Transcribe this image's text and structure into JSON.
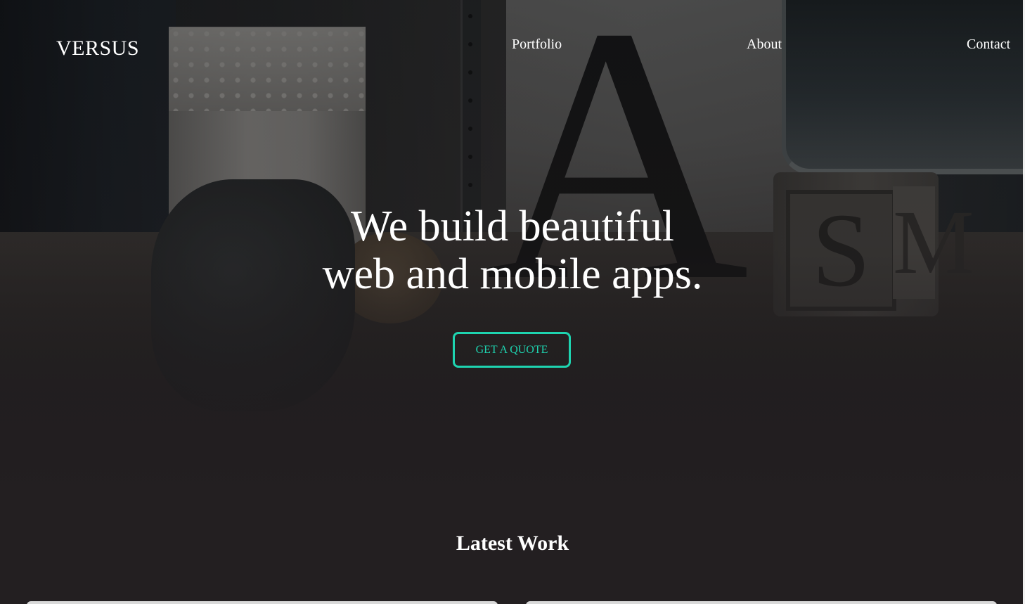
{
  "nav": {
    "brand": "VERSUS",
    "links": [
      {
        "label": "Portfolio"
      },
      {
        "label": "About"
      },
      {
        "label": "Contact"
      }
    ]
  },
  "hero": {
    "title_line1": "We build beautiful",
    "title_line2": "web and mobile apps.",
    "cta_label": "GET A QUOTE",
    "accent_color": "#1ed4b0"
  },
  "latest_work": {
    "title": "Latest Work"
  }
}
